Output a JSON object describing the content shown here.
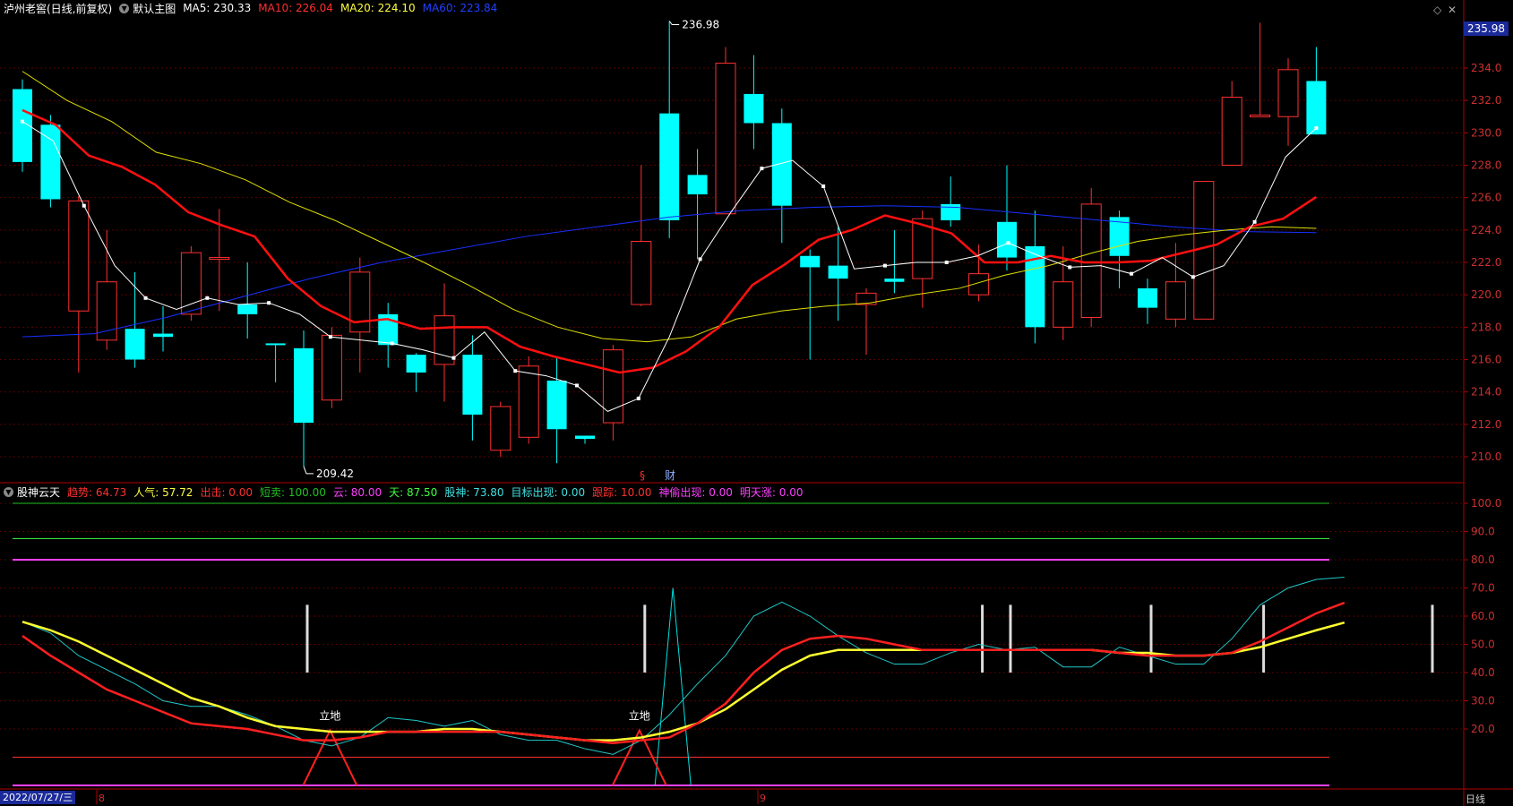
{
  "main_header": {
    "title": "泸州老窖(日线,前复权)",
    "chart_name": "默认主图",
    "ma5": "MA5: 230.33",
    "ma10": "MA10: 226.04",
    "ma20": "MA20: 224.10",
    "ma60": "MA60: 223.84"
  },
  "sub_header": {
    "title": "股神云天",
    "items": [
      {
        "text": "趋势: 64.73",
        "color": "#ff3030"
      },
      {
        "text": "人气: 57.72",
        "color": "#ffff40"
      },
      {
        "text": "出击: 0.00",
        "color": "#ff3030"
      },
      {
        "text": "短卖: 100.00",
        "color": "#20c020"
      },
      {
        "text": "云: 80.00",
        "color": "#ff40ff"
      },
      {
        "text": "天: 87.50",
        "color": "#40ff40"
      },
      {
        "text": "股神: 73.80",
        "color": "#40e0e0"
      },
      {
        "text": "目标出现: 0.00",
        "color": "#40e0e0"
      },
      {
        "text": "跟踪: 10.00",
        "color": "#ff3030"
      },
      {
        "text": "神偷出现: 0.00",
        "color": "#ff40ff"
      },
      {
        "text": "明天涨: 0.00",
        "color": "#ff40ff"
      }
    ]
  },
  "current_price": "235.98",
  "price_axis_labels": [
    "234.0",
    "232.0",
    "230.0",
    "228.0",
    "226.0",
    "224.0",
    "222.0",
    "220.0",
    "218.0",
    "216.0",
    "214.0",
    "212.0",
    "210.0"
  ],
  "indicator_axis_labels": [
    "100.0",
    "90.0",
    "80.0",
    "70.0",
    "60.0",
    "50.0",
    "40.0",
    "30.0",
    "20.0"
  ],
  "annotations": {
    "high": "236.98",
    "low": "209.42",
    "marker_s": "§",
    "marker_cai": "财",
    "lidi": "立地"
  },
  "footer": {
    "date": "2022/07/27/三",
    "month_8": "8",
    "month_9": "9",
    "period": "日线"
  },
  "chart_data": {
    "type": "candlestick",
    "ylim": [
      208.5,
      236.2
    ],
    "candles": [
      [
        232.7,
        228.2,
        233.3,
        227.6
      ],
      [
        230.5,
        225.9,
        231.1,
        225.4
      ],
      [
        219.0,
        225.8,
        226.1,
        215.2
      ],
      [
        217.2,
        220.8,
        224.0,
        216.6
      ],
      [
        217.9,
        216.0,
        221.4,
        215.5
      ],
      [
        217.6,
        217.4,
        219.3,
        216.5
      ],
      [
        218.8,
        222.6,
        223.0,
        218.4
      ],
      [
        222.3,
        222.3,
        225.3,
        219.0
      ],
      [
        219.4,
        218.8,
        222.0,
        217.3
      ],
      [
        217.0,
        216.9,
        217.0,
        214.6
      ],
      [
        216.7,
        212.1,
        217.8,
        209.4
      ],
      [
        213.5,
        217.5,
        218.0,
        213.0
      ],
      [
        217.7,
        221.4,
        222.3,
        215.2
      ],
      [
        218.8,
        216.9,
        219.5,
        215.5
      ],
      [
        216.3,
        215.2,
        216.4,
        214.0
      ],
      [
        215.7,
        218.7,
        220.7,
        213.4
      ],
      [
        216.3,
        212.6,
        217.5,
        211.0
      ],
      [
        210.4,
        213.1,
        213.4,
        210.0
      ],
      [
        211.2,
        215.6,
        216.2,
        210.8
      ],
      [
        214.7,
        211.7,
        216.2,
        209.6
      ],
      [
        211.3,
        211.1,
        211.3,
        210.8
      ],
      [
        212.1,
        216.6,
        216.9,
        211.0
      ],
      [
        219.4,
        223.3,
        228.0,
        219.3
      ],
      [
        231.2,
        224.6,
        236.9,
        223.5
      ],
      [
        227.4,
        226.2,
        229.0,
        222.2
      ],
      [
        225.0,
        234.3,
        235.3,
        225.0
      ],
      [
        232.4,
        230.6,
        234.8,
        229.0
      ],
      [
        230.6,
        225.5,
        231.5,
        223.2
      ],
      [
        222.4,
        221.7,
        222.8,
        216.0
      ],
      [
        221.8,
        221.0,
        224.2,
        218.4
      ],
      [
        219.4,
        220.1,
        220.4,
        216.3
      ],
      [
        221.0,
        220.8,
        224.0,
        220.1
      ],
      [
        221.0,
        224.7,
        225.2,
        219.2
      ],
      [
        225.6,
        224.6,
        227.3,
        224.2
      ],
      [
        220.0,
        221.3,
        223.1,
        219.6
      ],
      [
        224.5,
        222.3,
        228.0,
        221.5
      ],
      [
        223.0,
        218.0,
        225.2,
        217.0
      ],
      [
        218.0,
        220.8,
        223.0,
        217.2
      ],
      [
        218.6,
        225.6,
        226.6,
        218.0
      ],
      [
        224.8,
        222.4,
        225.2,
        220.4
      ],
      [
        220.4,
        219.2,
        221.0,
        218.2
      ],
      [
        218.5,
        220.8,
        223.2,
        218.0
      ],
      [
        218.5,
        227.0,
        227.0,
        218.5
      ],
      [
        228.0,
        232.2,
        233.2,
        228.0
      ],
      [
        231.1,
        231.1,
        236.8,
        231.0
      ],
      [
        231.0,
        233.9,
        234.6,
        229.2
      ],
      [
        233.2,
        229.9,
        235.3,
        229.9
      ]
    ],
    "ma5": [
      230.7,
      229.5,
      225.5,
      221.8,
      219.8,
      219.1,
      219.8,
      219.4,
      219.5,
      218.8,
      217.4,
      217.2,
      217.0,
      216.6,
      216.1,
      217.7,
      215.3,
      215.0,
      214.4,
      212.8,
      213.6,
      217.4,
      222.2,
      225.1,
      227.8,
      228.3,
      226.7,
      221.6,
      221.8,
      222.0,
      222.0,
      222.4,
      223.2,
      222.4,
      221.7,
      221.8,
      221.3,
      222.3,
      221.1,
      221.8,
      224.5,
      228.5,
      230.3
    ],
    "ma10": [
      231.4,
      230.5,
      228.6,
      227.9,
      226.8,
      225.1,
      224.3,
      223.6,
      221.0,
      219.3,
      218.3,
      218.5,
      217.9,
      218.0,
      218.0,
      216.8,
      216.2,
      215.7,
      215.2,
      215.5,
      216.5,
      218.0,
      220.6,
      221.9,
      223.4,
      224.0,
      224.9,
      224.4,
      223.8,
      222.0,
      222.0,
      222.4,
      222.0,
      222.0,
      222.1,
      222.6,
      223.1,
      224.2,
      224.7,
      226.04
    ],
    "ma20": [
      233.8,
      232.0,
      230.7,
      228.8,
      228.1,
      227.1,
      225.7,
      224.6,
      223.3,
      222.0,
      220.6,
      219.1,
      218.0,
      217.3,
      217.1,
      217.4,
      218.5,
      219.0,
      219.3,
      219.5,
      220.0,
      220.4,
      221.2,
      221.8,
      222.6,
      223.3,
      223.7,
      224.0,
      224.2,
      224.1
    ],
    "ma60": [
      217.4,
      217.6,
      218.6,
      219.8,
      221.0,
      222.0,
      222.8,
      223.6,
      224.2,
      224.8,
      225.2,
      225.4,
      225.5,
      225.4,
      225.0,
      224.6,
      224.2,
      223.9,
      223.84
    ],
    "indicator": {
      "trend": [
        53,
        46,
        40,
        34,
        30,
        26,
        22,
        21,
        20,
        18,
        16,
        16,
        17,
        19,
        19,
        19,
        19,
        19,
        18,
        17,
        16,
        15,
        16,
        17,
        22,
        29,
        40,
        48,
        52,
        53,
        52,
        50,
        48,
        48,
        48,
        48,
        48,
        48,
        48,
        47,
        46,
        46,
        46,
        47,
        51,
        56,
        61,
        64.73
      ],
      "popularity": [
        58,
        55,
        51,
        46,
        41,
        36,
        31,
        28,
        24,
        21,
        20,
        19,
        19,
        19,
        19,
        20,
        20,
        19,
        18,
        17,
        16,
        16,
        17,
        19,
        22,
        27,
        34,
        41,
        46,
        48,
        48,
        48,
        48,
        48,
        48,
        48,
        48,
        48,
        48,
        47,
        47,
        46,
        46,
        47,
        49,
        52,
        55,
        57.72
      ],
      "yuntian": [
        58,
        54,
        46,
        41,
        36,
        30,
        28,
        28,
        25,
        21,
        16,
        14,
        17,
        24,
        23,
        21,
        23,
        18,
        16,
        16,
        13,
        11,
        16,
        25,
        36,
        46,
        60,
        65,
        60,
        53,
        47,
        43,
        43,
        47,
        50,
        48,
        49,
        42,
        42,
        49,
        46,
        43,
        43,
        52,
        64,
        70,
        73,
        73.8
      ],
      "white_bars_x": [
        10,
        22,
        34,
        35,
        40,
        44,
        50
      ],
      "lidi_at": [
        11,
        22
      ],
      "cyan_spike_at": 23,
      "hlines": [
        {
          "value": 100,
          "color": "#20c020"
        },
        {
          "value": 87.5,
          "color": "#40ff40"
        },
        {
          "value": 80,
          "color": "#ff40ff"
        },
        {
          "value": 10,
          "color": "#ff3030"
        }
      ]
    }
  }
}
